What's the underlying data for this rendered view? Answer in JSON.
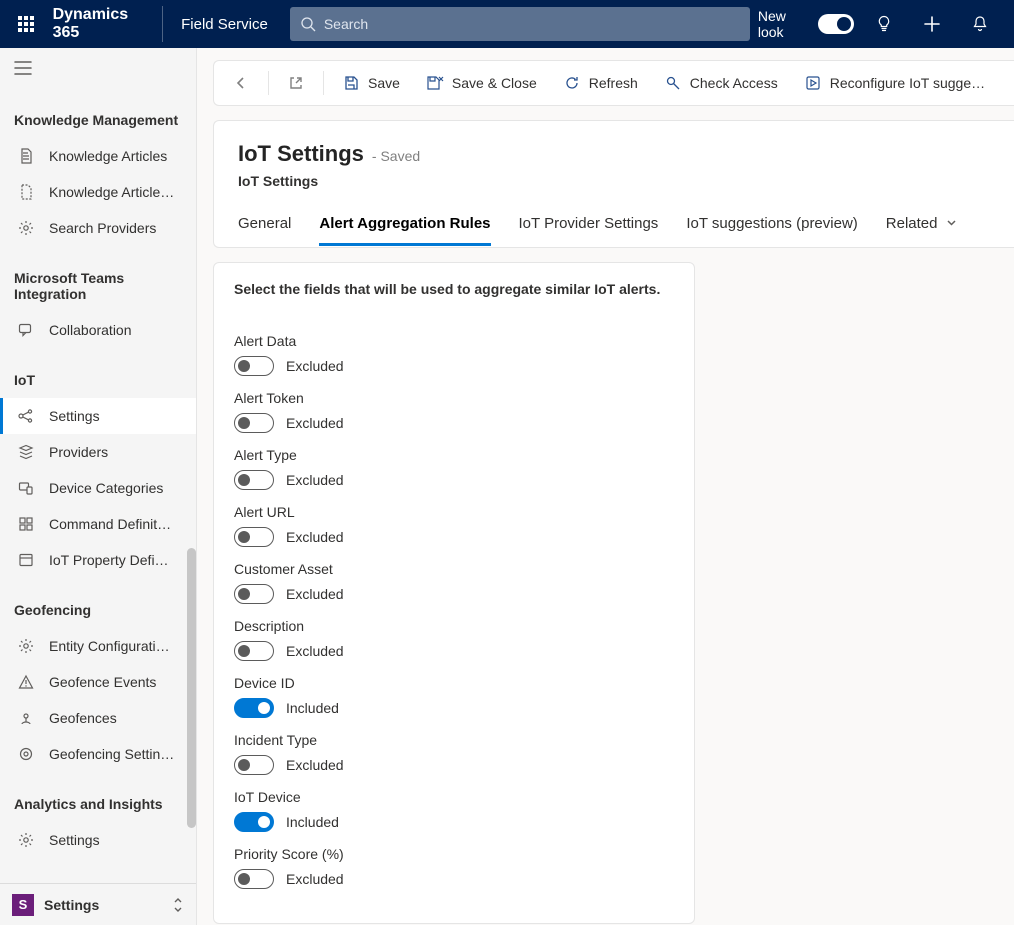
{
  "header": {
    "brand": "Dynamics 365",
    "app": "Field Service",
    "search_placeholder": "Search",
    "new_look": "New look"
  },
  "sidebar": {
    "sections": {
      "knowledge": {
        "title": "Knowledge Management",
        "items": [
          "Knowledge Articles",
          "Knowledge Article…",
          "Search Providers"
        ]
      },
      "teams": {
        "title": "Microsoft Teams Integration",
        "items": [
          "Collaboration"
        ]
      },
      "iot": {
        "title": "IoT",
        "items": [
          "Settings",
          "Providers",
          "Device Categories",
          "Command Definit…",
          "IoT Property Defi…"
        ]
      },
      "geofencing": {
        "title": "Geofencing",
        "items": [
          "Entity Configurati…",
          "Geofence Events",
          "Geofences",
          "Geofencing Settin…"
        ]
      },
      "analytics": {
        "title": "Analytics and Insights",
        "items": [
          "Settings"
        ]
      }
    },
    "area_badge": "S",
    "area_name": "Settings"
  },
  "commands": {
    "save": "Save",
    "save_close": "Save & Close",
    "refresh": "Refresh",
    "check_access": "Check Access",
    "reconfigure": "Reconfigure IoT sugge…"
  },
  "page": {
    "title": "IoT Settings",
    "saved": "- Saved",
    "entity": "IoT Settings",
    "tabs": [
      "General",
      "Alert Aggregation Rules",
      "IoT Provider Settings",
      "IoT suggestions (preview)",
      "Related"
    ],
    "active_tab": 1
  },
  "panel": {
    "lead": "Select the fields that will be used to aggregate similar IoT alerts.",
    "state_on": "Included",
    "state_off": "Excluded",
    "fields": [
      {
        "label": "Alert Data",
        "on": false
      },
      {
        "label": "Alert Token",
        "on": false
      },
      {
        "label": "Alert Type",
        "on": false
      },
      {
        "label": "Alert URL",
        "on": false
      },
      {
        "label": "Customer Asset",
        "on": false
      },
      {
        "label": "Description",
        "on": false
      },
      {
        "label": "Device ID",
        "on": true
      },
      {
        "label": "Incident Type",
        "on": false
      },
      {
        "label": "IoT Device",
        "on": true
      },
      {
        "label": "Priority Score (%)",
        "on": false
      }
    ]
  }
}
